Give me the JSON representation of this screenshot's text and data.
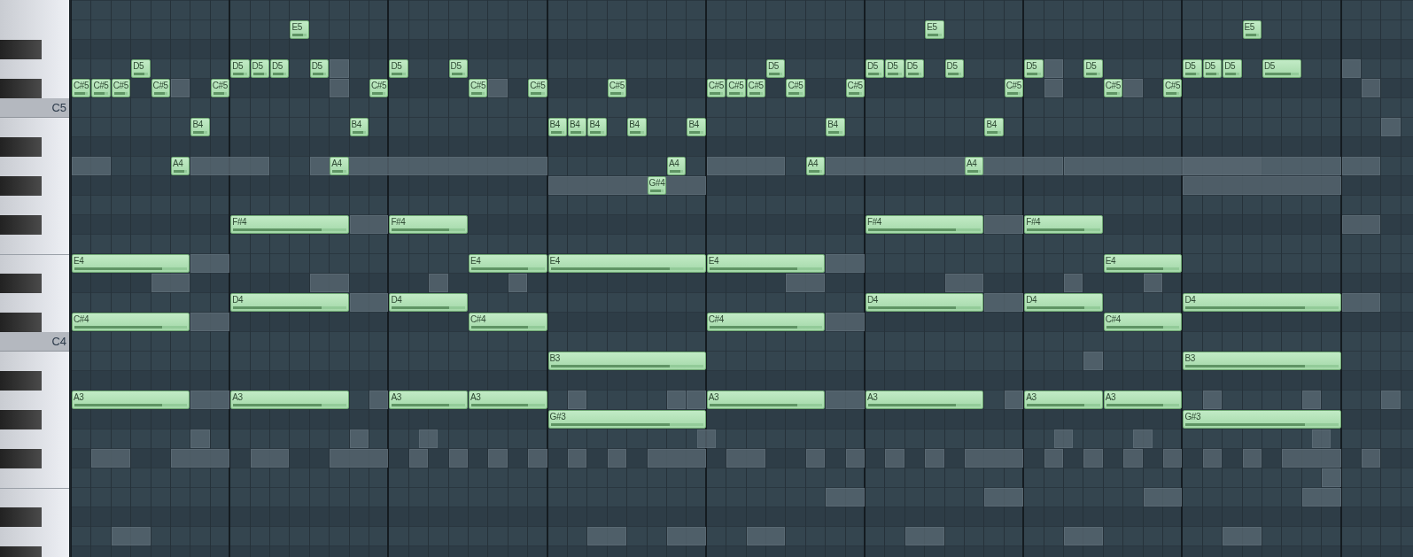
{
  "keyboard": {
    "labels": [
      {
        "label": "C5"
      },
      {
        "label": "C4"
      }
    ]
  },
  "notes": [
    {
      "label": "E5",
      "level": 0.78
    },
    {
      "label": "E5",
      "level": 0.78
    },
    {
      "label": "E5",
      "level": 0.78
    },
    {
      "label": "D5",
      "level": 0.78
    },
    {
      "label": "D5",
      "level": 0.78
    },
    {
      "label": "D5",
      "level": 0.78
    },
    {
      "label": "D5",
      "level": 0.78
    },
    {
      "label": "D5",
      "level": 0.78
    },
    {
      "label": "D5",
      "level": 0.78
    },
    {
      "label": "D5",
      "level": 0.78
    },
    {
      "label": "D5",
      "level": 0.78
    },
    {
      "label": "D5",
      "level": 0.78
    },
    {
      "label": "D5",
      "level": 0.78
    },
    {
      "label": "D5",
      "level": 0.78
    },
    {
      "label": "D5",
      "level": 0.78
    },
    {
      "label": "D5",
      "level": 0.78
    },
    {
      "label": "D5",
      "level": 0.78
    },
    {
      "label": "D5",
      "level": 0.78
    },
    {
      "label": "D5",
      "level": 0.78
    },
    {
      "label": "D5",
      "level": 0.78
    },
    {
      "label": "D5",
      "level": 0.78
    },
    {
      "label": "C#5",
      "level": 0.78
    },
    {
      "label": "C#5",
      "level": 0.78
    },
    {
      "label": "C#5",
      "level": 0.78
    },
    {
      "label": "C#5",
      "level": 0.78
    },
    {
      "label": "C#5",
      "level": 0.78
    },
    {
      "label": "C#5",
      "level": 0.78
    },
    {
      "label": "C#5",
      "level": 0.78
    },
    {
      "label": "C#5",
      "level": 0.78
    },
    {
      "label": "C#5",
      "level": 0.78
    },
    {
      "label": "C#5",
      "level": 0.78
    },
    {
      "label": "C#5",
      "level": 0.78
    },
    {
      "label": "C#5",
      "level": 0.78
    },
    {
      "label": "C#5",
      "level": 0.78
    },
    {
      "label": "C#5",
      "level": 0.78
    },
    {
      "label": "C#5",
      "level": 0.78
    },
    {
      "label": "C#5",
      "level": 0.78
    },
    {
      "label": "C#5",
      "level": 0.78
    },
    {
      "label": "B4",
      "level": 0.78
    },
    {
      "label": "B4",
      "level": 0.78
    },
    {
      "label": "B4",
      "level": 0.78
    },
    {
      "label": "B4",
      "level": 0.78
    },
    {
      "label": "B4",
      "level": 0.78
    },
    {
      "label": "B4",
      "level": 0.78
    },
    {
      "label": "B4",
      "level": 0.78
    },
    {
      "label": "B4",
      "level": 0.78
    },
    {
      "label": "B4",
      "level": 0.78
    },
    {
      "label": "A4",
      "level": 0.78
    },
    {
      "label": "A4",
      "level": 0.78
    },
    {
      "label": "A4",
      "level": 0.78
    },
    {
      "label": "A4",
      "level": 0.78
    },
    {
      "label": "A4",
      "level": 0.78
    },
    {
      "label": "G#4",
      "level": 0.78
    },
    {
      "label": "F#4",
      "level": 0.78
    },
    {
      "label": "F#4",
      "level": 0.78
    },
    {
      "label": "F#4",
      "level": 0.78
    },
    {
      "label": "F#4",
      "level": 0.78
    },
    {
      "label": "E4",
      "level": 0.78
    },
    {
      "label": "E4",
      "level": 0.78
    },
    {
      "label": "E4",
      "level": 0.78
    },
    {
      "label": "E4",
      "level": 0.78
    },
    {
      "label": "E4",
      "level": 0.78
    },
    {
      "label": "D4",
      "level": 0.78
    },
    {
      "label": "D4",
      "level": 0.78
    },
    {
      "label": "D4",
      "level": 0.78
    },
    {
      "label": "D4",
      "level": 0.78
    },
    {
      "label": "D4",
      "level": 0.78
    },
    {
      "label": "C#4",
      "level": 0.78
    },
    {
      "label": "C#4",
      "level": 0.78
    },
    {
      "label": "C#4",
      "level": 0.78
    },
    {
      "label": "C#4",
      "level": 0.78
    },
    {
      "label": "B3",
      "level": 0.78
    },
    {
      "label": "B3",
      "level": 0.78
    },
    {
      "label": "A3",
      "level": 0.78
    },
    {
      "label": "A3",
      "level": 0.78
    },
    {
      "label": "A3",
      "level": 0.78
    },
    {
      "label": "A3",
      "level": 0.78
    },
    {
      "label": "A3",
      "level": 0.78
    },
    {
      "label": "A3",
      "level": 0.78
    },
    {
      "label": "A3",
      "level": 0.78
    },
    {
      "label": "A3",
      "level": 0.78
    },
    {
      "label": "G#3",
      "level": 0.78
    },
    {
      "label": "G#3",
      "level": 0.78
    }
  ]
}
